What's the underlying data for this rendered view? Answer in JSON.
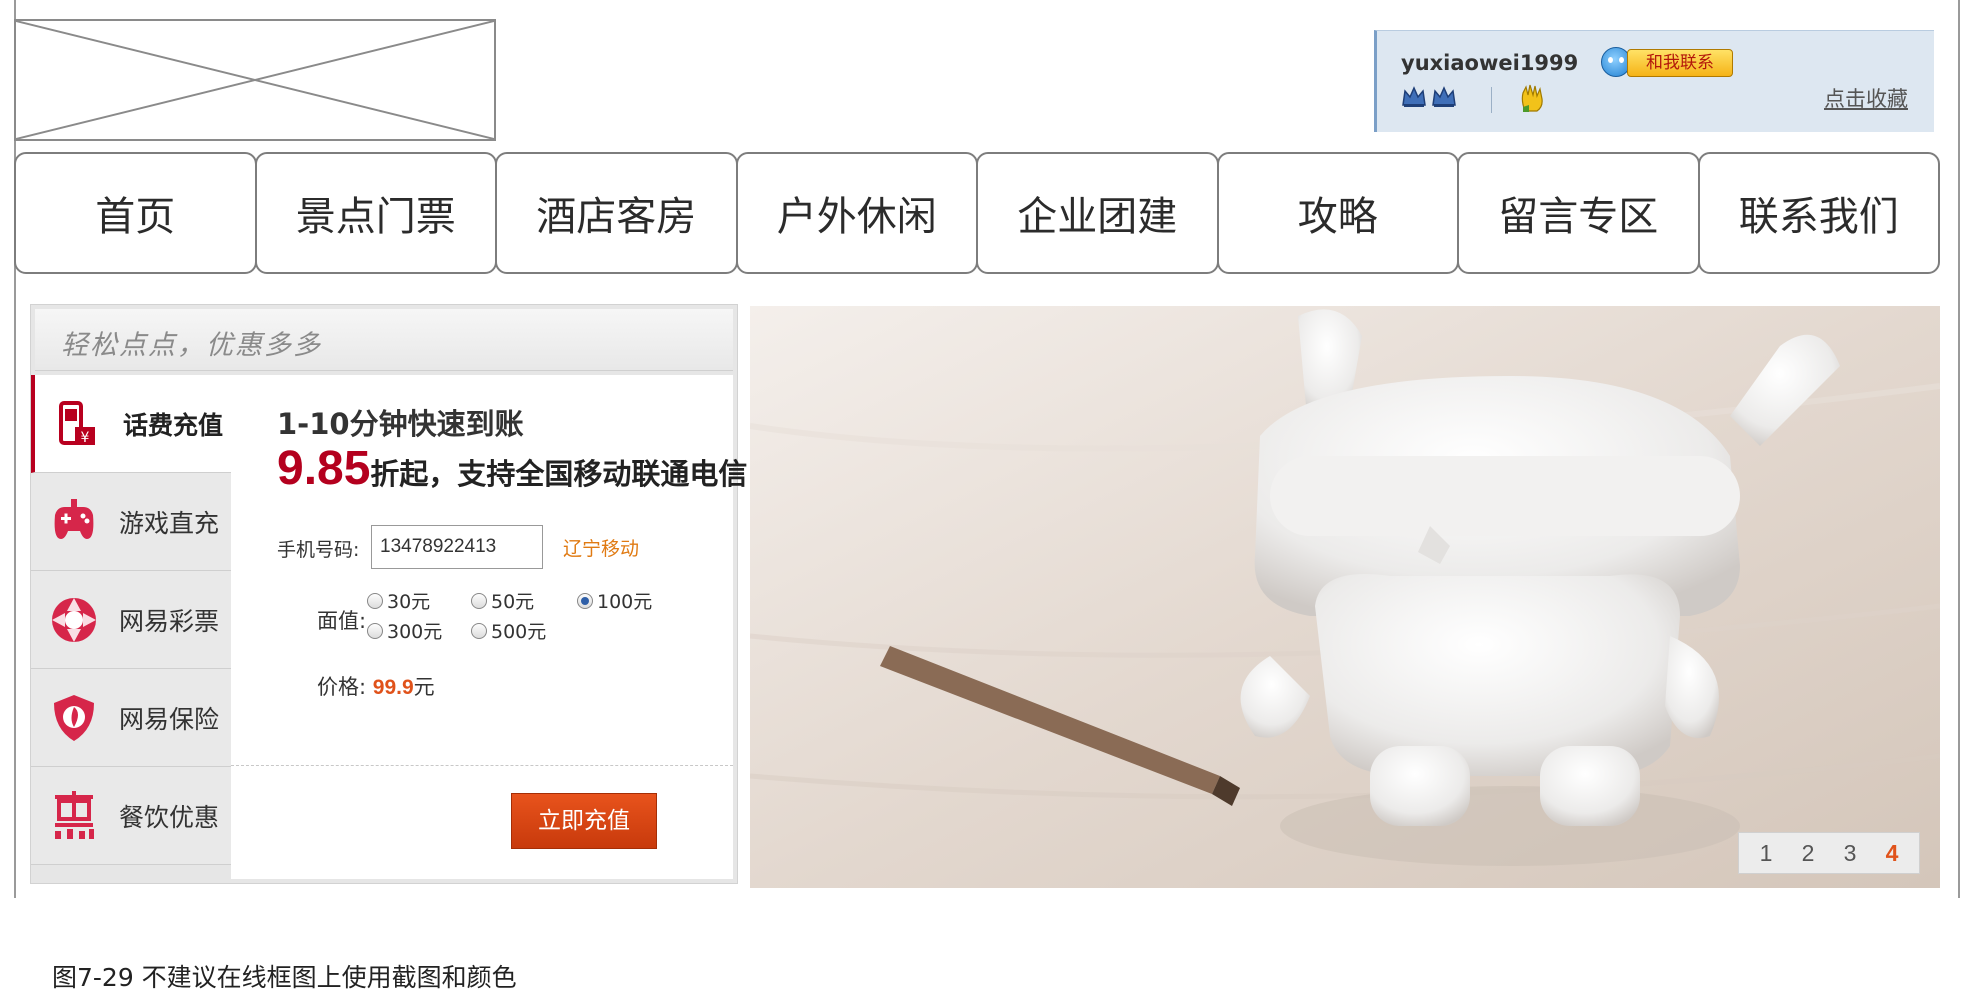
{
  "user_box": {
    "username": "yuxiaowei1999",
    "contact_label": "和我联系",
    "favorite_label": "点击收藏"
  },
  "nav": {
    "items": [
      "首页",
      "景点门票",
      "酒店客房",
      "户外休闲",
      "企业团建",
      "攻略",
      "留言专区",
      "联系我们"
    ]
  },
  "recharge_panel": {
    "slogan": "轻松点点，优惠多多",
    "tabs": [
      {
        "label": "话费充值",
        "icon": "phone-recharge-icon",
        "active": true
      },
      {
        "label": "游戏直充",
        "icon": "gamepad-icon",
        "active": false
      },
      {
        "label": "网易彩票",
        "icon": "lottery-icon",
        "active": false
      },
      {
        "label": "网易保险",
        "icon": "insurance-shield-icon",
        "active": false
      },
      {
        "label": "餐饮优惠",
        "icon": "dining-hui-icon",
        "active": false
      }
    ],
    "promo_line1": "1-10分钟快速到账",
    "discount": "9.85",
    "promo_line2": "折起，支持全国移动联通电信",
    "phone_label": "手机号码:",
    "phone_value": "13478922413",
    "carrier": "辽宁移动",
    "face_value_label": "面值:",
    "options": [
      {
        "label": "30元",
        "checked": false
      },
      {
        "label": "50元",
        "checked": false
      },
      {
        "label": "100元",
        "checked": true
      },
      {
        "label": "300元",
        "checked": false
      },
      {
        "label": "500元",
        "checked": false
      }
    ],
    "price_label": "价格:",
    "price_value": "99.9",
    "price_unit": "元",
    "submit_label": "立即充值"
  },
  "banner": {
    "pages": [
      "1",
      "2",
      "3",
      "4"
    ],
    "current_page": "4"
  },
  "caption": "图7-29 不建议在线框图上使用截图和颜色",
  "colors": {
    "brand_red": "#b4001e",
    "orange": "#e0521a",
    "userbox_bg": "#dde7f1"
  }
}
